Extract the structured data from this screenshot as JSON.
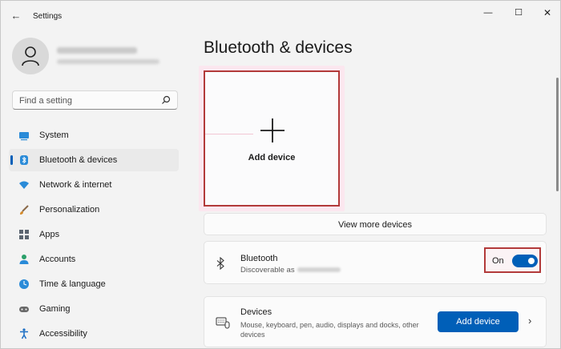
{
  "window": {
    "title": "Settings",
    "controls": {
      "minimize": "—",
      "maximize": "☐",
      "close": "✕"
    }
  },
  "search": {
    "placeholder": "Find a setting"
  },
  "sidebar": {
    "items": [
      {
        "label": "System",
        "icon": "monitor-icon",
        "active": false
      },
      {
        "label": "Bluetooth & devices",
        "icon": "bluetooth-devices-icon",
        "active": true
      },
      {
        "label": "Network & internet",
        "icon": "wifi-icon",
        "active": false
      },
      {
        "label": "Personalization",
        "icon": "brush-icon",
        "active": false
      },
      {
        "label": "Apps",
        "icon": "apps-icon",
        "active": false
      },
      {
        "label": "Accounts",
        "icon": "person-icon",
        "active": false
      },
      {
        "label": "Time & language",
        "icon": "globe-clock-icon",
        "active": false
      },
      {
        "label": "Gaming",
        "icon": "gamepad-icon",
        "active": false
      },
      {
        "label": "Accessibility",
        "icon": "accessibility-icon",
        "active": false
      }
    ]
  },
  "main": {
    "title": "Bluetooth & devices",
    "add_tile": {
      "label": "Add device"
    },
    "view_more": {
      "label": "View more devices"
    },
    "bluetooth": {
      "title": "Bluetooth",
      "subtitle": "Discoverable as",
      "toggle_state": "On",
      "toggle_on": true
    },
    "devices": {
      "title": "Devices",
      "subtitle": "Mouse, keyboard, pen, audio, displays and docks, other devices",
      "button": "Add device"
    }
  },
  "colors": {
    "accent": "#005fb8",
    "highlight_border": "#b23a3a"
  }
}
